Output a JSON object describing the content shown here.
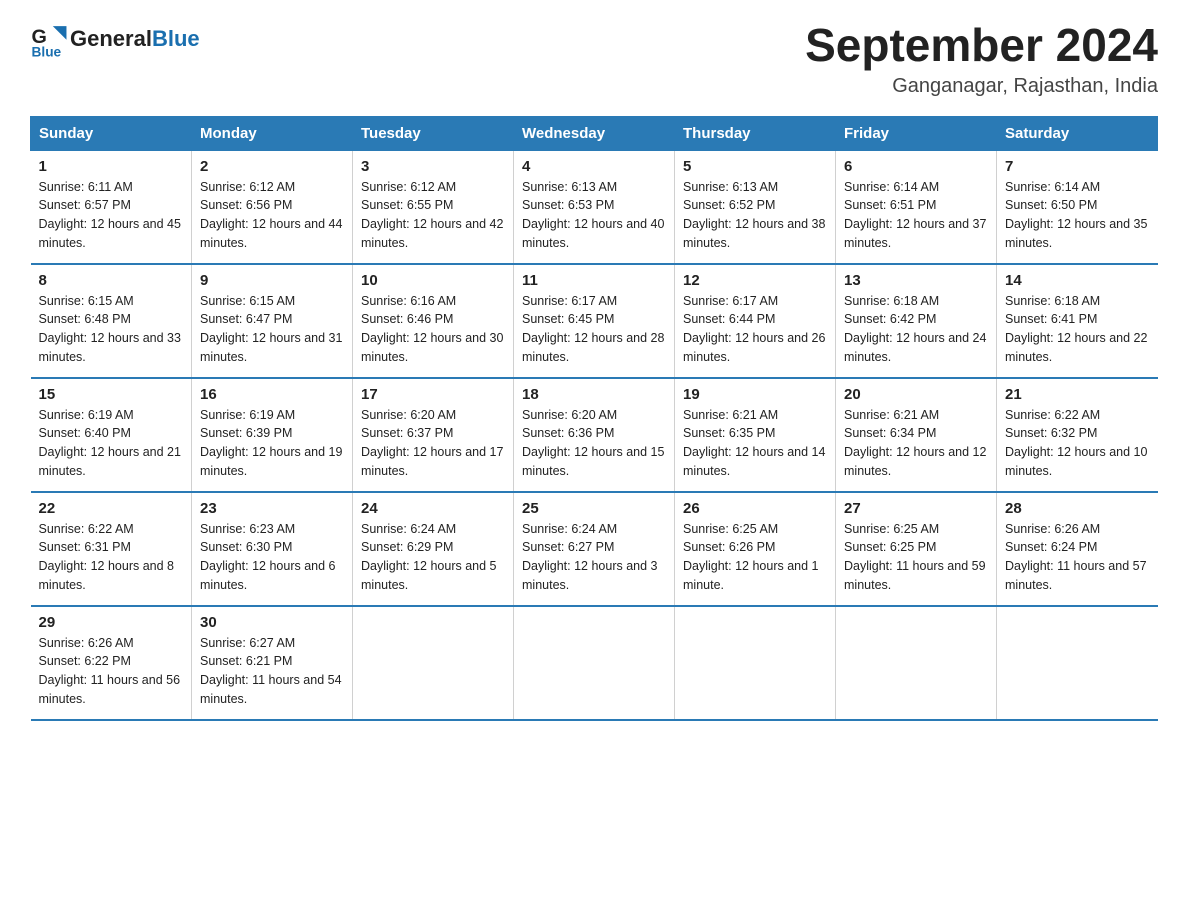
{
  "logo": {
    "text_general": "General",
    "text_blue": "Blue"
  },
  "title": {
    "month_year": "September 2024",
    "location": "Ganganagar, Rajasthan, India"
  },
  "weekdays": [
    "Sunday",
    "Monday",
    "Tuesday",
    "Wednesday",
    "Thursday",
    "Friday",
    "Saturday"
  ],
  "weeks": [
    [
      {
        "day": "1",
        "sunrise": "Sunrise: 6:11 AM",
        "sunset": "Sunset: 6:57 PM",
        "daylight": "Daylight: 12 hours and 45 minutes."
      },
      {
        "day": "2",
        "sunrise": "Sunrise: 6:12 AM",
        "sunset": "Sunset: 6:56 PM",
        "daylight": "Daylight: 12 hours and 44 minutes."
      },
      {
        "day": "3",
        "sunrise": "Sunrise: 6:12 AM",
        "sunset": "Sunset: 6:55 PM",
        "daylight": "Daylight: 12 hours and 42 minutes."
      },
      {
        "day": "4",
        "sunrise": "Sunrise: 6:13 AM",
        "sunset": "Sunset: 6:53 PM",
        "daylight": "Daylight: 12 hours and 40 minutes."
      },
      {
        "day": "5",
        "sunrise": "Sunrise: 6:13 AM",
        "sunset": "Sunset: 6:52 PM",
        "daylight": "Daylight: 12 hours and 38 minutes."
      },
      {
        "day": "6",
        "sunrise": "Sunrise: 6:14 AM",
        "sunset": "Sunset: 6:51 PM",
        "daylight": "Daylight: 12 hours and 37 minutes."
      },
      {
        "day": "7",
        "sunrise": "Sunrise: 6:14 AM",
        "sunset": "Sunset: 6:50 PM",
        "daylight": "Daylight: 12 hours and 35 minutes."
      }
    ],
    [
      {
        "day": "8",
        "sunrise": "Sunrise: 6:15 AM",
        "sunset": "Sunset: 6:48 PM",
        "daylight": "Daylight: 12 hours and 33 minutes."
      },
      {
        "day": "9",
        "sunrise": "Sunrise: 6:15 AM",
        "sunset": "Sunset: 6:47 PM",
        "daylight": "Daylight: 12 hours and 31 minutes."
      },
      {
        "day": "10",
        "sunrise": "Sunrise: 6:16 AM",
        "sunset": "Sunset: 6:46 PM",
        "daylight": "Daylight: 12 hours and 30 minutes."
      },
      {
        "day": "11",
        "sunrise": "Sunrise: 6:17 AM",
        "sunset": "Sunset: 6:45 PM",
        "daylight": "Daylight: 12 hours and 28 minutes."
      },
      {
        "day": "12",
        "sunrise": "Sunrise: 6:17 AM",
        "sunset": "Sunset: 6:44 PM",
        "daylight": "Daylight: 12 hours and 26 minutes."
      },
      {
        "day": "13",
        "sunrise": "Sunrise: 6:18 AM",
        "sunset": "Sunset: 6:42 PM",
        "daylight": "Daylight: 12 hours and 24 minutes."
      },
      {
        "day": "14",
        "sunrise": "Sunrise: 6:18 AM",
        "sunset": "Sunset: 6:41 PM",
        "daylight": "Daylight: 12 hours and 22 minutes."
      }
    ],
    [
      {
        "day": "15",
        "sunrise": "Sunrise: 6:19 AM",
        "sunset": "Sunset: 6:40 PM",
        "daylight": "Daylight: 12 hours and 21 minutes."
      },
      {
        "day": "16",
        "sunrise": "Sunrise: 6:19 AM",
        "sunset": "Sunset: 6:39 PM",
        "daylight": "Daylight: 12 hours and 19 minutes."
      },
      {
        "day": "17",
        "sunrise": "Sunrise: 6:20 AM",
        "sunset": "Sunset: 6:37 PM",
        "daylight": "Daylight: 12 hours and 17 minutes."
      },
      {
        "day": "18",
        "sunrise": "Sunrise: 6:20 AM",
        "sunset": "Sunset: 6:36 PM",
        "daylight": "Daylight: 12 hours and 15 minutes."
      },
      {
        "day": "19",
        "sunrise": "Sunrise: 6:21 AM",
        "sunset": "Sunset: 6:35 PM",
        "daylight": "Daylight: 12 hours and 14 minutes."
      },
      {
        "day": "20",
        "sunrise": "Sunrise: 6:21 AM",
        "sunset": "Sunset: 6:34 PM",
        "daylight": "Daylight: 12 hours and 12 minutes."
      },
      {
        "day": "21",
        "sunrise": "Sunrise: 6:22 AM",
        "sunset": "Sunset: 6:32 PM",
        "daylight": "Daylight: 12 hours and 10 minutes."
      }
    ],
    [
      {
        "day": "22",
        "sunrise": "Sunrise: 6:22 AM",
        "sunset": "Sunset: 6:31 PM",
        "daylight": "Daylight: 12 hours and 8 minutes."
      },
      {
        "day": "23",
        "sunrise": "Sunrise: 6:23 AM",
        "sunset": "Sunset: 6:30 PM",
        "daylight": "Daylight: 12 hours and 6 minutes."
      },
      {
        "day": "24",
        "sunrise": "Sunrise: 6:24 AM",
        "sunset": "Sunset: 6:29 PM",
        "daylight": "Daylight: 12 hours and 5 minutes."
      },
      {
        "day": "25",
        "sunrise": "Sunrise: 6:24 AM",
        "sunset": "Sunset: 6:27 PM",
        "daylight": "Daylight: 12 hours and 3 minutes."
      },
      {
        "day": "26",
        "sunrise": "Sunrise: 6:25 AM",
        "sunset": "Sunset: 6:26 PM",
        "daylight": "Daylight: 12 hours and 1 minute."
      },
      {
        "day": "27",
        "sunrise": "Sunrise: 6:25 AM",
        "sunset": "Sunset: 6:25 PM",
        "daylight": "Daylight: 11 hours and 59 minutes."
      },
      {
        "day": "28",
        "sunrise": "Sunrise: 6:26 AM",
        "sunset": "Sunset: 6:24 PM",
        "daylight": "Daylight: 11 hours and 57 minutes."
      }
    ],
    [
      {
        "day": "29",
        "sunrise": "Sunrise: 6:26 AM",
        "sunset": "Sunset: 6:22 PM",
        "daylight": "Daylight: 11 hours and 56 minutes."
      },
      {
        "day": "30",
        "sunrise": "Sunrise: 6:27 AM",
        "sunset": "Sunset: 6:21 PM",
        "daylight": "Daylight: 11 hours and 54 minutes."
      },
      null,
      null,
      null,
      null,
      null
    ]
  ]
}
